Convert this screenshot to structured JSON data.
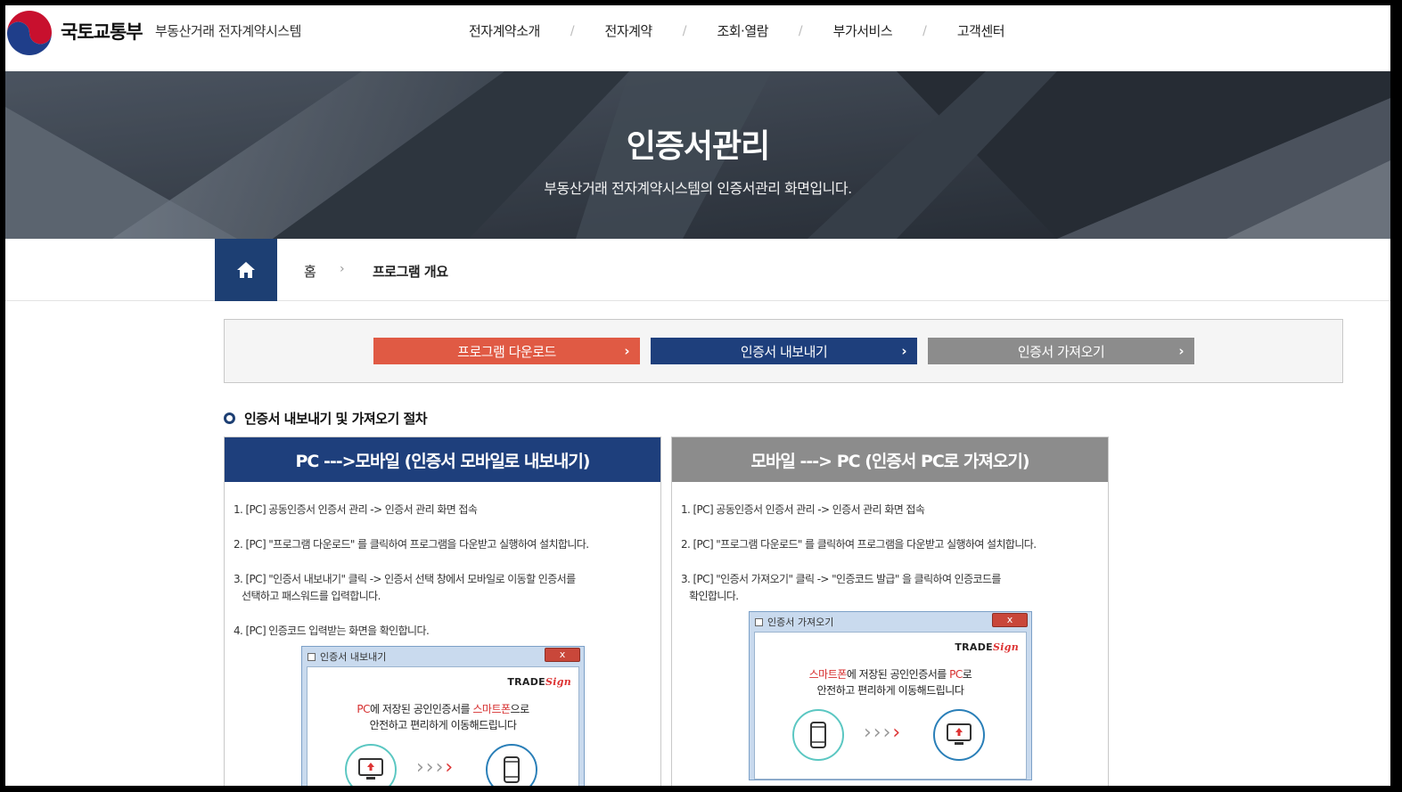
{
  "header": {
    "ministry": "국토교통부",
    "system_name": "부동산거래 전자계약시스템",
    "nav": [
      "전자계약소개",
      "전자계약",
      "조회·열람",
      "부가서비스",
      "고객센터"
    ],
    "nav_separator": "/"
  },
  "hero": {
    "title": "인증서관리",
    "subtitle": "부동산거래 전자계약시스템의 인증서관리 화면입니다."
  },
  "breadcrumb": {
    "home": "홈",
    "arrow": "›",
    "current": "프로그램 개요"
  },
  "actions": {
    "download": "프로그램 다운로드",
    "export": "인증서 내보내기",
    "import": "인증서 가져오기",
    "chevron": "›"
  },
  "section": {
    "title": "인증서 내보내기 및 가져오기 절차"
  },
  "panels": {
    "left": {
      "title": "PC --->모바일 (인증서 모바일로 내보내기)",
      "steps": [
        "1. [PC] 공동인증서 인증서 관리 -> 인증서 관리 화면 접속",
        "2. [PC] \"프로그램 다운로드\" 를 클릭하여 프로그램을 다운받고 실행하여 설치합니다.",
        "3. [PC] \"인증서 내보내기\" 클릭 -> 인증서 선택 창에서 모바일로 이동할 인증서를",
        "선택하고 패스워드를 입력합니다.",
        "4. [PC] 인증코드 입력받는 화면을 확인합니다."
      ],
      "dialog": {
        "title": "인증서 내보내기",
        "close": "x",
        "brand": "TRADE",
        "brand_sign": "Sign",
        "msg1_a": "PC",
        "msg1_b": "에 저장된 공인인증서를 ",
        "msg1_c": "스마트폰",
        "msg1_d": "으로",
        "msg2": "안전하고 편리하게 이동해드립니다",
        "chevrons_gray": "›››",
        "chevrons_red": "›"
      }
    },
    "right": {
      "title": "모바일 ---> PC (인증서 PC로 가져오기)",
      "steps": [
        "1. [PC] 공동인증서 인증서 관리 -> 인증서 관리 화면 접속",
        "2. [PC] \"프로그램 다운로드\" 를 클릭하여 프로그램을 다운받고 실행하여 설치합니다.",
        "3. [PC] \"인증서 가져오기\" 클릭 -> \"인증코드 발급\" 을 클릭하여 인증코드를",
        "확인합니다."
      ],
      "dialog": {
        "title": "인증서 가져오기",
        "close": "x",
        "brand": "TRADE",
        "brand_sign": "Sign",
        "msg1_a": "스마트폰",
        "msg1_b": "에 저장된 공인인증서를 ",
        "msg1_c": "PC",
        "msg1_d": "로",
        "msg2": "안전하고 편리하게 이동해드립니다",
        "chevrons_gray": "›››",
        "chevrons_red": "›"
      }
    }
  },
  "colors": {
    "navy": "#1e3f7c",
    "orange": "#e05a44",
    "gray": "#8c8c8c"
  }
}
